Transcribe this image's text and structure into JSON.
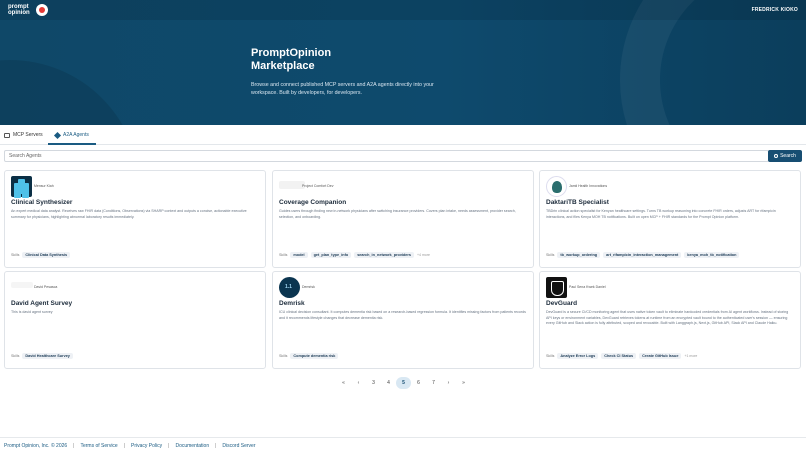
{
  "header": {
    "logo_text": "prompt opinion",
    "user_name": "FREDRICK KIOKO"
  },
  "hero": {
    "title": "PromptOpinion Marketplace",
    "subtitle": "Browse and connect published MCP servers and A2A agents directly into your workspace. Built by developers, for developers."
  },
  "tabs": [
    {
      "label": "MCP Servers",
      "active": false
    },
    {
      "label": "A2A Agents",
      "active": true
    }
  ],
  "search": {
    "placeholder": "Search Agents",
    "button_label": "Search"
  },
  "skills_label": "Skills",
  "cards": [
    {
      "publisher": "Mensur Kiah",
      "title": "Clinical Synthesizer",
      "description": "An expert medical data analyst. Receives raw FHIR data (Conditions, Observations) via SHARP context and outputs a concise, actionable executive summary for physicians, highlighting abnormal laboratory results immediately.",
      "skills": [
        "Clinical Data Synthesis"
      ],
      "more": ""
    },
    {
      "publisher": "Project Comfort Dev",
      "title": "Coverage Companion",
      "description": "Guides users through finding new in-network physicians after switching insurance providers. Covers plan intake, needs assessment, provider search, selection, and onboarding.",
      "skills": [
        "model",
        "get_plan_type_info",
        "search_in_network_providers"
      ],
      "more": "+4 more"
    },
    {
      "publisher": "Jamii Health Innovations",
      "title": "DaktariTB Specialist",
      "description": "TBDrin clinical action specialist for Kenyan healthcare settings. Turns TB workup reasoning into concrete FHIR orders, adjusts ART for rifampicin interactions, and files Kenya MOH TB notifications. Built on open MCP + FHIR standards for the Prompt Opinion platform.",
      "skills": [
        "tb_workup_ordering",
        "art_rifampicin_interaction_management",
        "kenya_moh_tb_notification"
      ],
      "more": ""
    },
    {
      "publisher": "David Pesasca",
      "title": "David Agent Survey",
      "description": "This is david agent survey",
      "skills": [
        "David Healthcare Survey"
      ],
      "more": ""
    },
    {
      "publisher": "Demrisk",
      "title": "Demrisk",
      "description": "ICU clinical decision consultant. It computes dementia risk based on a research-based regression formula. It identifies missing factors from patients records and it recommends lifestyle changes that decrease dementia risk.",
      "skills": [
        "Compute dementia risk"
      ],
      "more": ""
    },
    {
      "publisher": "Paul Sena Kwek Daniel",
      "title": "DevGuard",
      "description": "DevGuard is a secure CI/CD monitoring agent that uses native token vault to eliminate hardcoded credentials from AI agent workflows. Instead of storing API keys or environment variables, DevGuard retrieves tokens at runtime from an encrypted vault bound to the authenticated user's session — ensuring every GitHub and Slack action is fully attributed, scoped and revocable. Built with Langgraph.js, Next.js, GitHub API, Slack API and Claude Haiku.",
      "skills": [
        "Analyze Error Logs",
        "Check CI Status",
        "Create GitHub Issue"
      ],
      "more": "+1 more"
    }
  ],
  "pagination": {
    "first": "«",
    "prev": "‹",
    "pages": [
      "3",
      "4",
      "5",
      "6",
      "7"
    ],
    "active": "5",
    "next": "›",
    "last": "»"
  },
  "footer": {
    "copyright": "Prompt Opinion, Inc. © 2026",
    "links": [
      "Terms of Service",
      "Privacy Policy",
      "Documentation",
      "Discord Server"
    ]
  }
}
